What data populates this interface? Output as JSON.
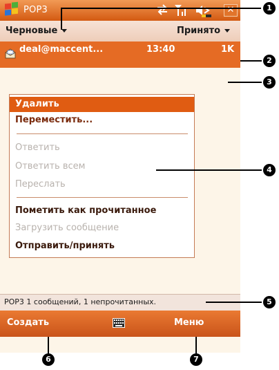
{
  "titlebar": {
    "title": "POP3"
  },
  "folderbar": {
    "folder": "Черновые",
    "filter": "Принято"
  },
  "message": {
    "from": "deal@maccent...",
    "time": "13:40",
    "size": "1K"
  },
  "menu": {
    "items": [
      {
        "label": "Удалить",
        "state": "selected"
      },
      {
        "label": "Переместить...",
        "state": "enabled"
      },
      {
        "label": "Ответить",
        "state": "disabled"
      },
      {
        "label": "Ответить всем",
        "state": "disabled"
      },
      {
        "label": "Переслать",
        "state": "disabled"
      },
      {
        "label": "Пометить как прочитанное",
        "state": "enabled"
      },
      {
        "label": "Загрузить сообщение",
        "state": "disabled"
      },
      {
        "label": "Отправить/принять",
        "state": "enabled"
      }
    ]
  },
  "statusbar": {
    "text": "POP3  1 сообщений, 1 непрочитанных."
  },
  "softkeys": {
    "left": "Создать",
    "right": "Меню"
  },
  "callouts": [
    "1",
    "2",
    "3",
    "4",
    "5",
    "6",
    "7"
  ],
  "colors": {
    "accent": "#e56b24",
    "selected": "#e05c12",
    "background": "#fdf5e8"
  }
}
